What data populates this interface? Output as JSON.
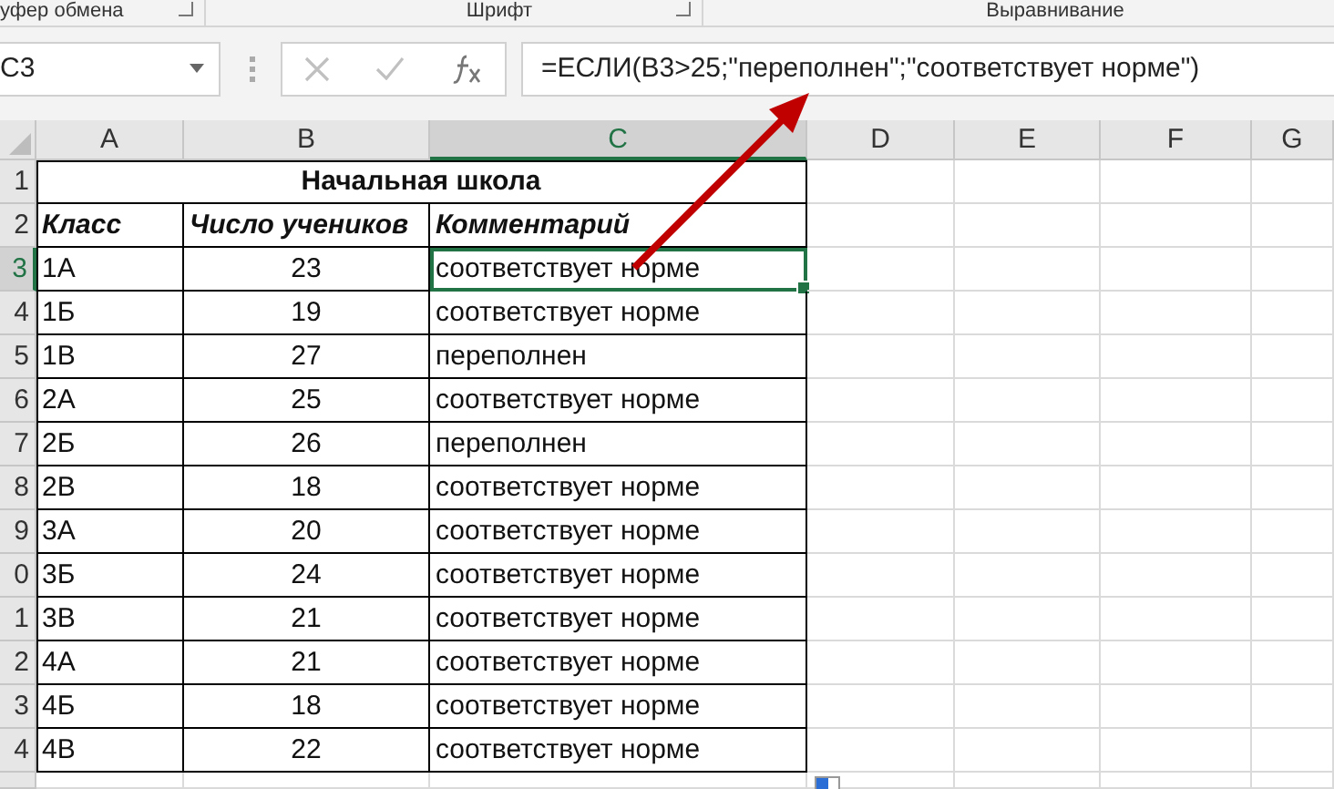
{
  "ribbon_groups": [
    {
      "label": "уфер обмена"
    },
    {
      "label": "Шрифт"
    },
    {
      "label": "Выравнивание"
    }
  ],
  "formula_bar": {
    "name_box": "C3",
    "formula": "=ЕСЛИ(B3>25;\"переполнен\";\"соответствует норме\")"
  },
  "columns": [
    {
      "label": "A",
      "selected": false
    },
    {
      "label": "B",
      "selected": false
    },
    {
      "label": "C",
      "selected": true
    },
    {
      "label": "D",
      "selected": false
    },
    {
      "label": "E",
      "selected": false
    },
    {
      "label": "F",
      "selected": false
    },
    {
      "label": "G",
      "selected": false
    }
  ],
  "row_headers": [
    {
      "label": "1",
      "selected": false
    },
    {
      "label": "2",
      "selected": false
    },
    {
      "label": "3",
      "selected": true
    },
    {
      "label": "4",
      "selected": false
    },
    {
      "label": "5",
      "selected": false
    },
    {
      "label": "6",
      "selected": false
    },
    {
      "label": "7",
      "selected": false
    },
    {
      "label": "8",
      "selected": false
    },
    {
      "label": "9",
      "selected": false
    },
    {
      "label": "0",
      "selected": false
    },
    {
      "label": "1",
      "selected": false
    },
    {
      "label": "2",
      "selected": false
    },
    {
      "label": "3",
      "selected": false
    },
    {
      "label": "4",
      "selected": false
    }
  ],
  "table": {
    "title": "Начальная школа",
    "headers": [
      "Класс",
      "Число учеников",
      "Комментарий"
    ],
    "rows": [
      {
        "class": "1А",
        "count": "23",
        "comment": "соответствует норме",
        "selected": true
      },
      {
        "class": "1Б",
        "count": "19",
        "comment": "соответствует норме",
        "selected": false
      },
      {
        "class": "1В",
        "count": "27",
        "comment": "переполнен",
        "selected": false
      },
      {
        "class": "2А",
        "count": "25",
        "comment": "соответствует норме",
        "selected": false
      },
      {
        "class": "2Б",
        "count": "26",
        "comment": "переполнен",
        "selected": false
      },
      {
        "class": "2В",
        "count": "18",
        "comment": "соответствует норме",
        "selected": false
      },
      {
        "class": "3А",
        "count": "20",
        "comment": "соответствует норме",
        "selected": false
      },
      {
        "class": "3Б",
        "count": "24",
        "comment": "соответствует норме",
        "selected": false
      },
      {
        "class": "3В",
        "count": "21",
        "comment": "соответствует норме",
        "selected": false
      },
      {
        "class": "4А",
        "count": "21",
        "comment": "соответствует норме",
        "selected": false
      },
      {
        "class": "4Б",
        "count": "18",
        "comment": "соответствует норме",
        "selected": false
      },
      {
        "class": "4В",
        "count": "22",
        "comment": "соответствует норме",
        "selected": false
      }
    ]
  }
}
